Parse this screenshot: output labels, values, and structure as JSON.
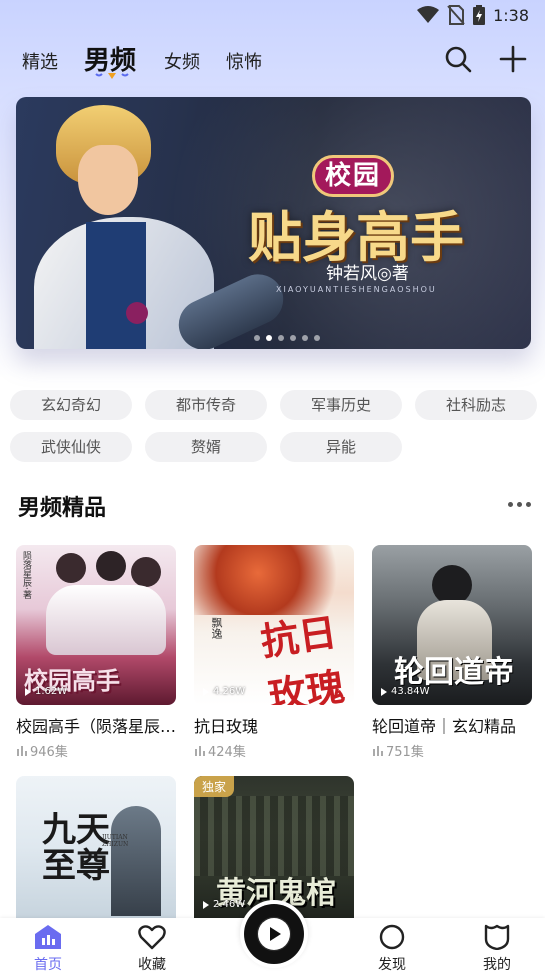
{
  "status_bar": {
    "time": "1:38"
  },
  "nav": {
    "tabs": [
      {
        "label": "精选"
      },
      {
        "label": "男频"
      },
      {
        "label": "女频"
      },
      {
        "label": "惊怖"
      }
    ],
    "active_tab": "男频"
  },
  "banner": {
    "tag": "校园",
    "title": "贴身高手",
    "author": "钟若风◎著",
    "subtitle": "XIAOYUANTIESHENGAOSHOU",
    "page_count": 6,
    "active_page": 1
  },
  "categories": [
    "玄幻奇幻",
    "都市传奇",
    "军事历史",
    "社科励志",
    "武侠仙侠",
    "赘婿",
    "异能"
  ],
  "section": {
    "title": "男频精品"
  },
  "books": [
    {
      "title": "校园高手（陨落星辰…",
      "count": "946集",
      "plays": "1.62W",
      "cover_text": "校园高手",
      "cover_side_text": "陨落星辰·著"
    },
    {
      "title": "抗日玫瑰",
      "count": "424集",
      "plays": "4.26W",
      "cover_text": "抗日玫瑰",
      "cover_side_text": "飘逸"
    },
    {
      "title": "轮回道帝｜玄幻精品",
      "count": "751集",
      "plays": "43.84W",
      "cover_text": "轮回道帝"
    },
    {
      "title": "",
      "count": "",
      "plays": "",
      "cover_text": "九天至尊",
      "cover_side_text": "JIUTIAN ZHIZUN"
    },
    {
      "title": "",
      "count": "",
      "plays": "2.46W",
      "cover_text": "黄河鬼棺",
      "badge": "独家"
    }
  ],
  "bottom_nav": {
    "items": [
      {
        "label": "首页",
        "icon": "home-chart-icon"
      },
      {
        "label": "收藏",
        "icon": "heart-icon"
      },
      {
        "label": "发现",
        "icon": "circle-icon"
      },
      {
        "label": "我的",
        "icon": "shield-face-icon"
      }
    ]
  },
  "colors": {
    "accent": "#6a6cf0",
    "tab_indicator": "#f0a020",
    "chip_bg": "#f1f1f3"
  }
}
